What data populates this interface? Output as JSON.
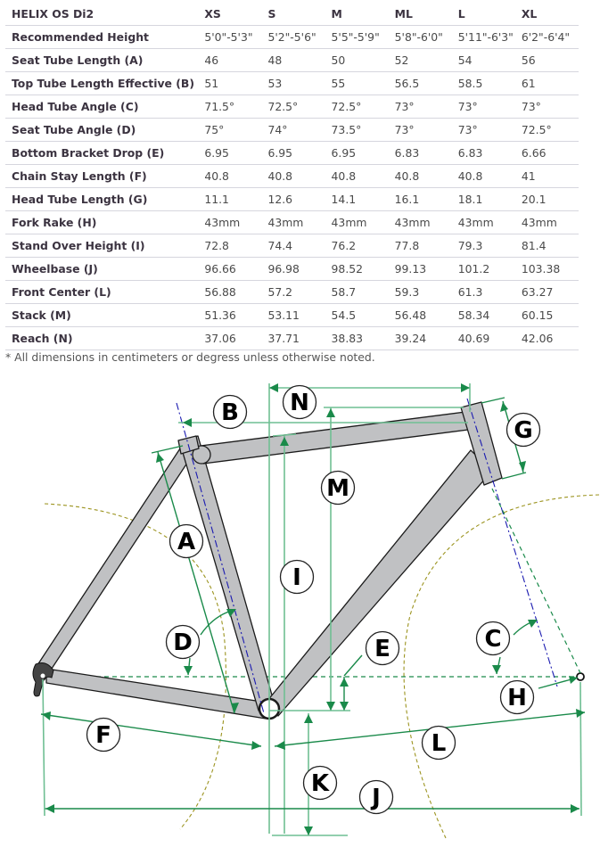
{
  "table": {
    "model": "HELIX OS Di2",
    "sizes": [
      "XS",
      "S",
      "M",
      "ML",
      "L",
      "XL"
    ],
    "rows": [
      {
        "label": "Recommended Height",
        "values": [
          "5'0\"-5'3\"",
          "5'2\"-5'6\"",
          "5'5\"-5'9\"",
          "5'8\"-6'0\"",
          "5'11\"-6'3\"",
          "6'2\"-6'4\""
        ]
      },
      {
        "label": "Seat Tube Length (A)",
        "values": [
          "46",
          "48",
          "50",
          "52",
          "54",
          "56"
        ]
      },
      {
        "label": "Top Tube Length Effective (B)",
        "values": [
          "51",
          "53",
          "55",
          "56.5",
          "58.5",
          "61"
        ]
      },
      {
        "label": "Head Tube Angle (C)",
        "values": [
          "71.5°",
          "72.5°",
          "72.5°",
          "73°",
          "73°",
          "73°"
        ]
      },
      {
        "label": "Seat Tube Angle (D)",
        "values": [
          "75°",
          "74°",
          "73.5°",
          "73°",
          "73°",
          "72.5°"
        ]
      },
      {
        "label": "Bottom Bracket Drop (E)",
        "values": [
          "6.95",
          "6.95",
          "6.95",
          "6.83",
          "6.83",
          "6.66"
        ]
      },
      {
        "label": "Chain Stay Length (F)",
        "values": [
          "40.8",
          "40.8",
          "40.8",
          "40.8",
          "40.8",
          "41"
        ]
      },
      {
        "label": "Head Tube Length (G)",
        "values": [
          "11.1",
          "12.6",
          "14.1",
          "16.1",
          "18.1",
          "20.1"
        ]
      },
      {
        "label": "Fork Rake (H)",
        "values": [
          "43mm",
          "43mm",
          "43mm",
          "43mm",
          "43mm",
          "43mm"
        ]
      },
      {
        "label": "Stand Over Height (I)",
        "values": [
          "72.8",
          "74.4",
          "76.2",
          "77.8",
          "79.3",
          "81.4"
        ]
      },
      {
        "label": "Wheelbase (J)",
        "values": [
          "96.66",
          "96.98",
          "98.52",
          "99.13",
          "101.2",
          "103.38"
        ]
      },
      {
        "label": "Front Center (L)",
        "values": [
          "56.88",
          "57.2",
          "58.7",
          "59.3",
          "61.3",
          "63.27"
        ]
      },
      {
        "label": "Stack (M)",
        "values": [
          "51.36",
          "53.11",
          "54.5",
          "56.48",
          "58.34",
          "60.15"
        ]
      },
      {
        "label": "Reach (N)",
        "values": [
          "37.06",
          "37.71",
          "38.83",
          "39.24",
          "40.69",
          "42.06"
        ]
      }
    ]
  },
  "note": "* All dimensions in centimeters or degress unless otherwise noted.",
  "diagram": {
    "labels": {
      "A": "A",
      "B": "B",
      "C": "C",
      "D": "D",
      "E": "E",
      "F": "F",
      "G": "G",
      "H": "H",
      "I": "I",
      "J": "J",
      "K": "K",
      "L": "L",
      "M": "M",
      "N": "N"
    },
    "colors": {
      "dimension": "#1a8a4a",
      "dimension_light": "#6fbf93",
      "axis": "#1a1ab0",
      "wheel_arc": "#9c9420",
      "tube_fill": "#c0c1c3"
    }
  }
}
